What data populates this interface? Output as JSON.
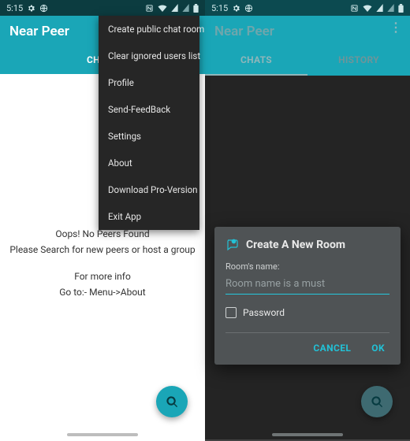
{
  "colors": {
    "brand": "#1aa6b7",
    "accent": "#22c1d6"
  },
  "status": {
    "time": "5:15",
    "icons_left": [
      "gear-icon",
      "globe-icon"
    ],
    "icons_right": [
      "nfc-icon",
      "wifi-icon",
      "signal-icon",
      "signal-2-icon",
      "battery-icon"
    ]
  },
  "app": {
    "title": "Near Peer"
  },
  "tabs": {
    "chats": "CHATS",
    "history": "HISTORY"
  },
  "menu": {
    "items": [
      "Create public chat room",
      "Clear ignored users list",
      "Profile",
      "Send-FeedBack",
      "Settings",
      "About",
      "Download Pro-Version",
      "Exit App"
    ]
  },
  "empty": {
    "line1": "Oops! No Peers Found",
    "line2": "Please Search for new peers or host a group",
    "line3": "For more info",
    "line4": "Go to:- Menu->About"
  },
  "dialog": {
    "title": "Create A New Room",
    "field_label": "Room's name:",
    "placeholder": "Room name is a must",
    "password_label": "Password",
    "cancel": "CANCEL",
    "ok": "OK"
  },
  "fab": {
    "name": "search-fab"
  }
}
